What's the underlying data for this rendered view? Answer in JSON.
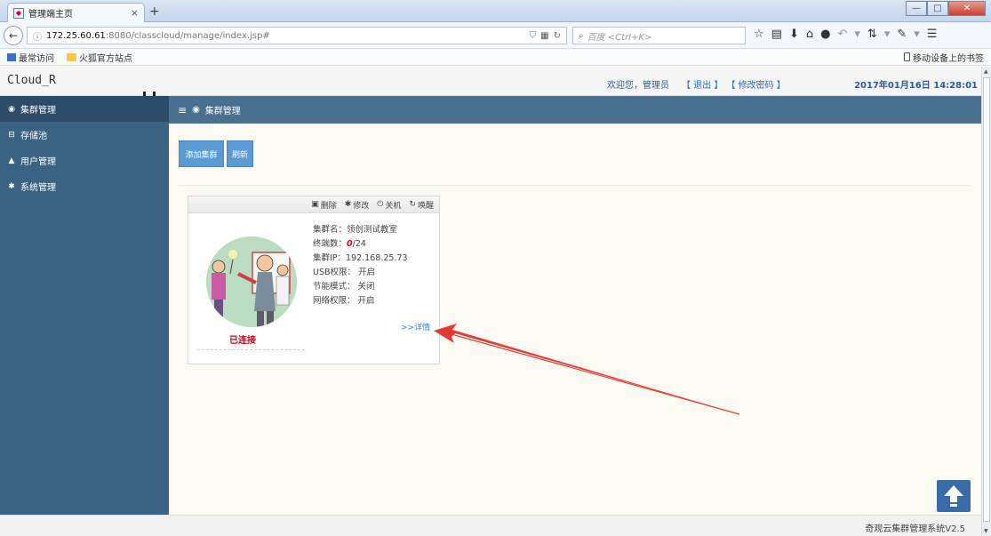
{
  "browser": {
    "tab_title": "管理端主页",
    "tab_close": "×",
    "new_tab": "+",
    "url_host": "172.25.60.61",
    "url_path": ":8080/classcloud/manage/index.jsp#",
    "search_placeholder": "百度 <Ctrl+K>",
    "bookmarks": [
      "最常访问",
      "火狐官方站点"
    ],
    "mobile_bookmarks": "移动设备上的书签"
  },
  "header": {
    "brand": "Cloud_R",
    "welcome": "欢迎您，管理员",
    "logout": "【 退出 】",
    "change_password": "【 修改密码 】",
    "datetime": "2017年01月16日 14:28:01"
  },
  "sidebar": {
    "items": [
      {
        "label": "集群管理",
        "icon": "dashboard-icon"
      },
      {
        "label": "存储池",
        "icon": "storage-icon"
      },
      {
        "label": "用户管理",
        "icon": "user-icon"
      },
      {
        "label": "系统管理",
        "icon": "gear-icon"
      }
    ]
  },
  "main": {
    "heading": "集群管理",
    "add_button": "添加集群",
    "refresh_button": "刷新"
  },
  "cluster_card": {
    "tools": {
      "delete": "删除",
      "edit": "修改",
      "shutdown": "关机",
      "wake": "唤醒"
    },
    "name_line": "集群名：领创测试教室",
    "terminals_prefix": "终端数：",
    "terminals_online": "0",
    "terminals_total": "/24",
    "ip_line": "集群IP：192.168.25.73",
    "usb_line": "USB权限： 开启",
    "power_line": "节能模式： 关闭",
    "network_line": "网络权限： 开启",
    "detail_link": ">>详情",
    "status": "已连接"
  },
  "footer": {
    "text": "奇观云集群管理系统V2.5"
  },
  "colors": {
    "sidebar": "#3a6283",
    "content_header": "#49708f",
    "button": "#5b9bd5",
    "status_red": "#d0021b",
    "annotation_arrow": "#e53935"
  }
}
